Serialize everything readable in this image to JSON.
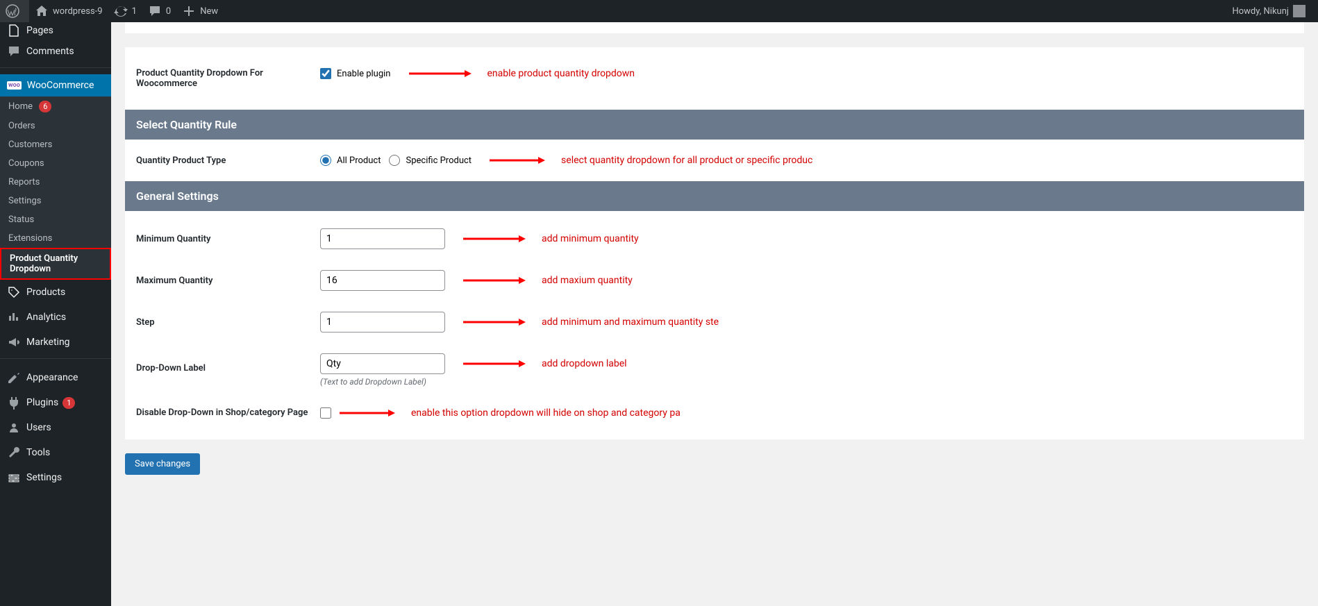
{
  "adminbar": {
    "site_name": "wordpress-9",
    "refresh_count": "1",
    "comment_count": "0",
    "new_label": "New",
    "howdy": "Howdy, Nikunj"
  },
  "sidebar": {
    "items": {
      "pages": "Pages",
      "comments": "Comments",
      "woocommerce": "WooCommerce",
      "products": "Products",
      "analytics": "Analytics",
      "marketing": "Marketing",
      "appearance": "Appearance",
      "plugins": "Plugins",
      "users": "Users",
      "tools": "Tools",
      "settings": "Settings"
    },
    "submenu": {
      "home": "Home",
      "home_badge": "6",
      "orders": "Orders",
      "customers": "Customers",
      "coupons": "Coupons",
      "reports": "Reports",
      "settings": "Settings",
      "status": "Status",
      "extensions": "Extensions",
      "pqd": "Product Quantity Dropdown"
    },
    "plugins_badge": "1"
  },
  "page": {
    "enable_label": "Product Quantity Dropdown For Woocommerce",
    "enable_checkbox_label": "Enable plugin",
    "section_rule": "Select Quantity Rule",
    "qpt_label": "Quantity Product Type",
    "qpt_all": "All Product",
    "qpt_specific": "Specific Product",
    "section_general": "General Settings",
    "min_qty_label": "Minimum Quantity",
    "min_qty_value": "1",
    "max_qty_label": "Maximum Quantity",
    "max_qty_value": "16",
    "step_label": "Step",
    "step_value": "1",
    "dd_label_label": "Drop-Down Label",
    "dd_label_value": "Qty",
    "dd_label_desc": "(Text to add Dropdown Label)",
    "disable_dd_label": "Disable Drop-Down in Shop/category Page",
    "save_button": "Save changes"
  },
  "annotations": {
    "enable": "enable product quantity dropdown",
    "qpt": "select quantity dropdown for all product or specific produc",
    "min": "add minimum quantity",
    "max": "add maxium quantity",
    "step": "add minimum and maximum quantity ste",
    "ddlabel": "add dropdown label",
    "disable": "enable this option dropdown will hide on shop and category pa"
  }
}
